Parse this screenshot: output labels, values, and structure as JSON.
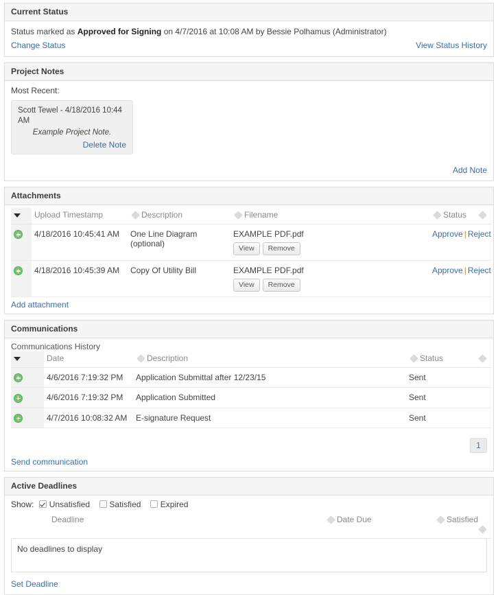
{
  "current_status": {
    "panel_title": "Current Status",
    "status_prefix": "Status marked as ",
    "status_value": "Approved for Signing",
    "status_suffix": " on 4/7/2016 at 10:08 AM by Bessie Polhamus (Administrator)",
    "change_status_link": "Change Status",
    "view_history_link": "View Status History"
  },
  "project_notes": {
    "panel_title": "Project Notes",
    "most_recent_label": "Most Recent:",
    "note": {
      "author_and_date": "Scott Tewel - 4/18/2016 10:44 AM",
      "body": "Example Project Note.",
      "delete_link": "Delete Note"
    },
    "add_note_link": "Add Note"
  },
  "attachments": {
    "panel_title": "Attachments",
    "columns": [
      "Upload Timestamp",
      "Description",
      "Filename",
      "Status"
    ],
    "rows": [
      {
        "timestamp": "4/18/2016 10:45:41 AM",
        "description": "One Line Diagram (optional)",
        "filename": "EXAMPLE PDF.pdf",
        "view_button": "View",
        "remove_button": "Remove",
        "approve_link": "Approve",
        "separator": "|",
        "reject_link": "Reject"
      },
      {
        "timestamp": "4/18/2016 10:45:39 AM",
        "description": "Copy Of Utility Bill",
        "filename": "EXAMPLE PDF.pdf",
        "view_button": "View",
        "remove_button": "Remove",
        "approve_link": "Approve",
        "separator": "|",
        "reject_link": "Reject"
      }
    ],
    "add_attachment_link": "Add attachment"
  },
  "communications": {
    "panel_title": "Communications",
    "history_label": "Communications History",
    "columns": [
      "Date",
      "Description",
      "Status"
    ],
    "rows": [
      {
        "date": "4/6/2016 7:19:32 PM",
        "description": "Application Submittal after 12/23/15",
        "status": "Sent"
      },
      {
        "date": "4/6/2016 7:19:32 PM",
        "description": "Application Submitted",
        "status": "Sent"
      },
      {
        "date": "4/7/2016 10:08:32 AM",
        "description": "E-signature Request",
        "status": "Sent"
      }
    ],
    "page_number": "1",
    "send_communication_link": "Send communication"
  },
  "active_deadlines": {
    "panel_title": "Active Deadlines",
    "show_label": "Show:",
    "filters": [
      {
        "label": "Unsatisfied",
        "checked": true
      },
      {
        "label": "Satisfied",
        "checked": false
      },
      {
        "label": "Expired",
        "checked": false
      }
    ],
    "columns": [
      "Deadline",
      "Date Due",
      "Satisfied"
    ],
    "empty_message": "No deadlines to display",
    "set_deadline_link": "Set Deadline"
  },
  "colors": {
    "link": "#3a6ea5",
    "panel_header_bg": "#f5f5f5",
    "border": "#dddddd",
    "expander_green": "#76c270",
    "separator_orange": "#d08a3a"
  }
}
